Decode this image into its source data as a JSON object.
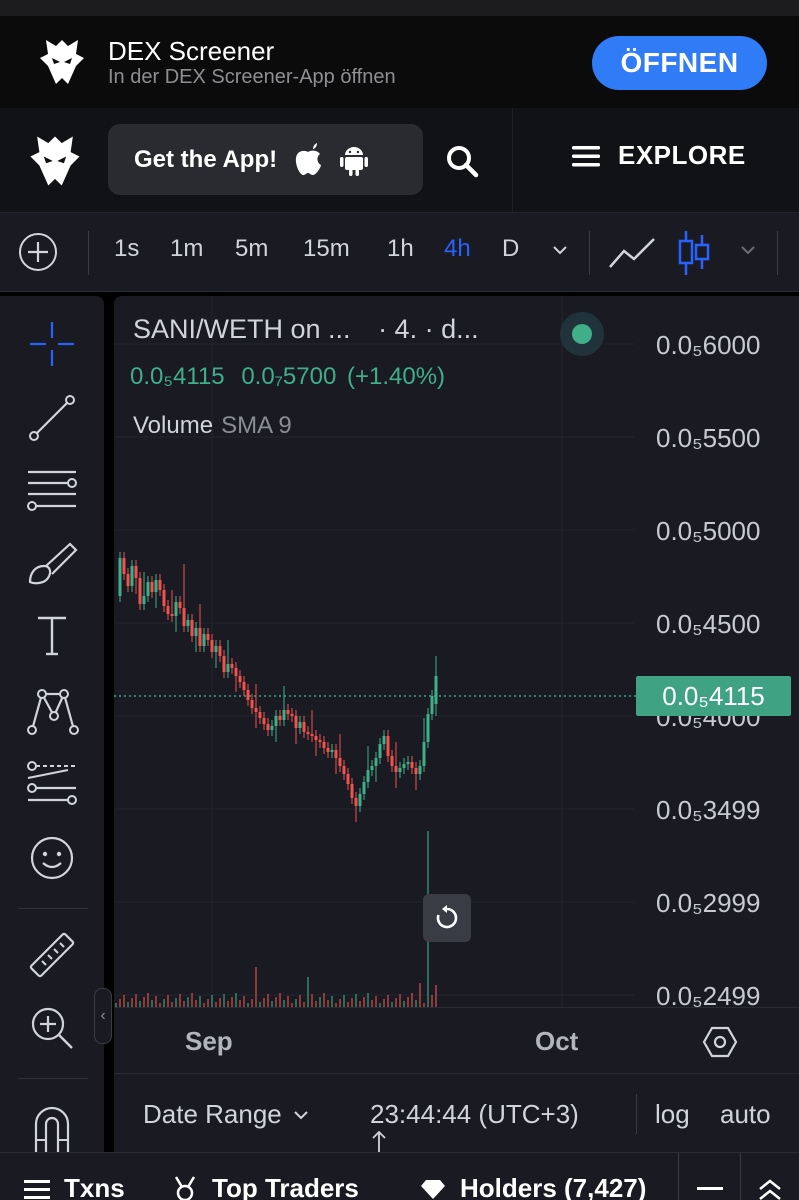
{
  "banner": {
    "app_name": "DEX Screener",
    "subtitle": "In der DEX Screener-App öffnen",
    "open_label": "ÖFFNEN"
  },
  "header": {
    "get_app_label": "Get the App!",
    "explore_label": "EXPLORE"
  },
  "toolbar": {
    "intervals": [
      "1s",
      "1m",
      "5m",
      "15m",
      "1h",
      "4h",
      "D"
    ],
    "active_interval": "4h"
  },
  "chart": {
    "legend_title": "SANI/WETH on ...",
    "legend_suffix": "· 4. · d...",
    "last_price": "0.0₅4115",
    "change_abs": "0.0₇5700",
    "change_pct": "(+1.40%)",
    "volume_label": "Volume",
    "volume_indicator": "SMA 9",
    "price_ticks": [
      "0.0₅6000",
      "0.0₅5500",
      "0.0₅5000",
      "0.0₅4500",
      "0.0₅4000",
      "0.0₅3499",
      "0.0₅2999",
      "0.0₅2499"
    ],
    "current_price_tag": "0.0₅4115",
    "time_labels": [
      "Sep",
      "Oct"
    ],
    "date_range_label": "Date Range",
    "clock": "23:44:44 (UTC+3)",
    "log_label": "log",
    "auto_label": "auto",
    "up_color": "#3fae89",
    "down_color": "#ef5350"
  },
  "tabs": {
    "txns": "Txns",
    "top_traders": "Top Traders",
    "holders": "Holders (7,427)"
  }
}
